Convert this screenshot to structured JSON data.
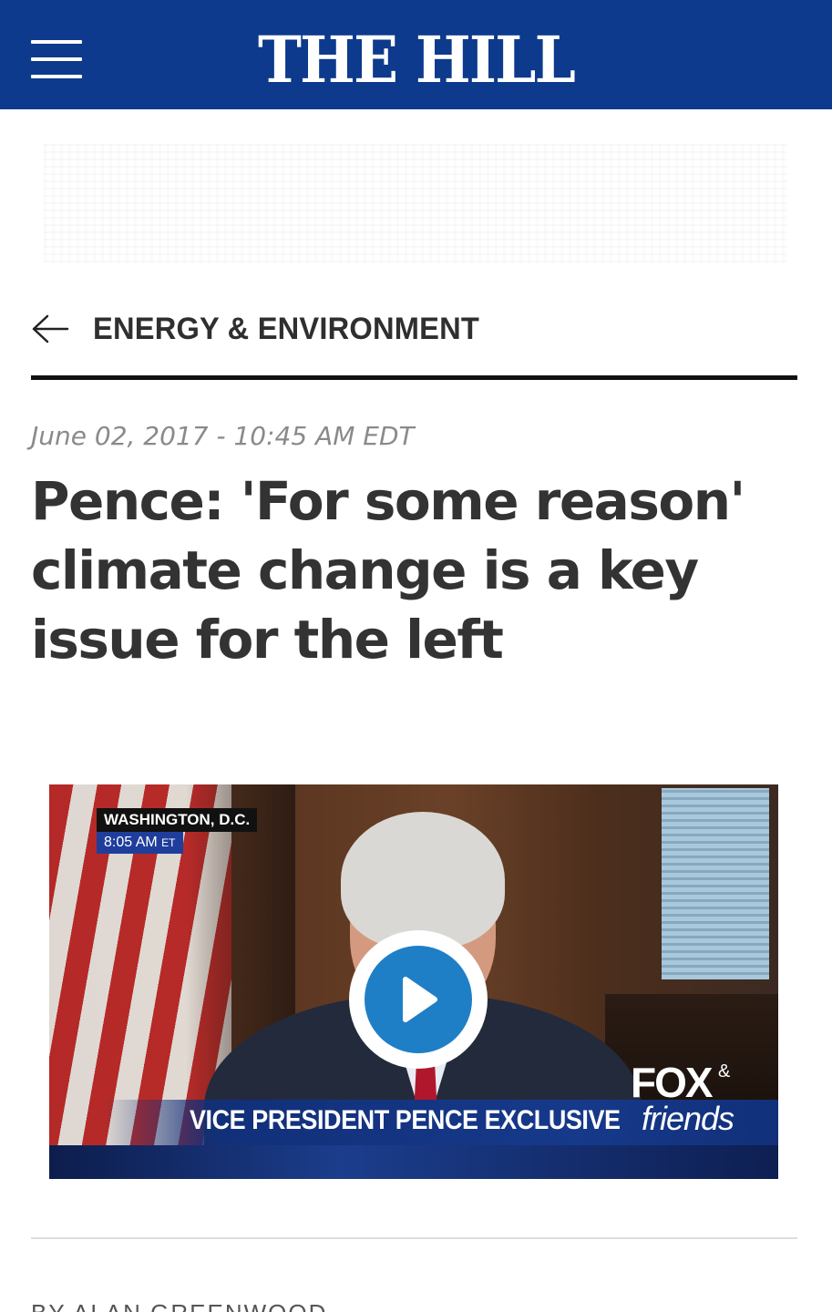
{
  "header": {
    "brand": "THE HILL",
    "background": "#0d3a8c",
    "menu_icon": "hamburger-menu-icon"
  },
  "section": {
    "back_icon": "arrow-left-icon",
    "label": "ENERGY & ENVIRONMENT"
  },
  "article": {
    "timestamp": "June 02, 2017 - 10:45 AM EDT",
    "headline": "Pence: 'For some reason' climate change is a key issue for the left",
    "byline": "BY ALAN GREENWOOD"
  },
  "video": {
    "location": "WASHINGTON, D.C.",
    "time": "8:05 AM",
    "time_zone": "ET",
    "lower_third": "VICE PRESIDENT PENCE EXCLUSIVE",
    "brand_fox": "FOX",
    "brand_amp": "&",
    "brand_friends": "friends",
    "play_icon": "play-icon",
    "play_color": "#1f7fc6"
  }
}
